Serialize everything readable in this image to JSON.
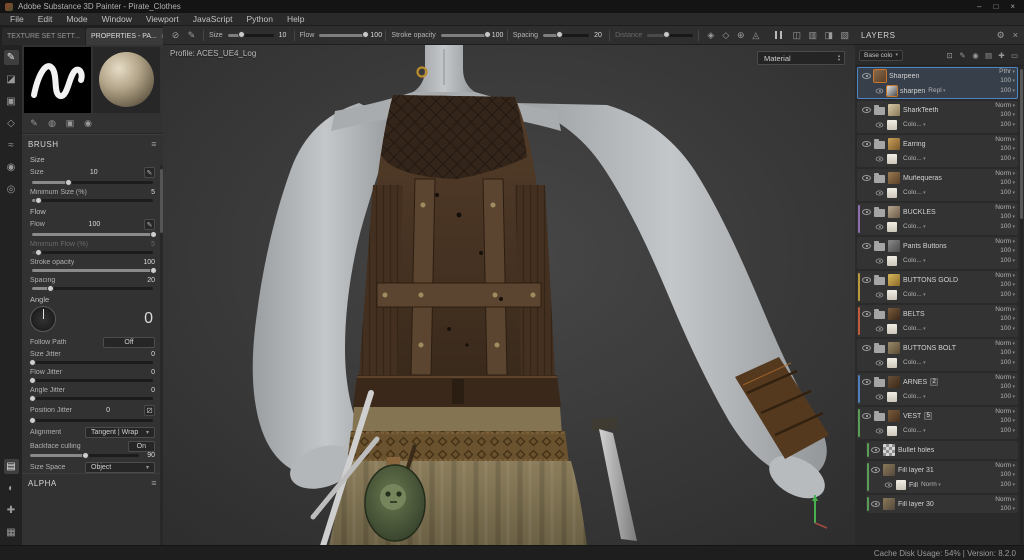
{
  "window": {
    "title": "Adobe Substance 3D Painter - Pirate_Clothes",
    "status": "Cache Disk Usage:  54% | Version: 8.2.0"
  },
  "icons": {
    "minimize": "–",
    "maximize": "□",
    "close": "×",
    "gear": "⚙",
    "caret": "▾",
    "up": "▲",
    "down": "▼",
    "pencil": "✎",
    "list": "≡"
  },
  "menus": [
    "File",
    "Edit",
    "Mode",
    "Window",
    "Viewport",
    "JavaScript",
    "Python",
    "Help"
  ],
  "dock_tabs": {
    "texture_set": "TEXTURE SET SETT...",
    "properties": "PROPERTIES - PA...",
    "close": "×"
  },
  "toolstrip": {
    "top": [
      {
        "name": "paint-tool-icon",
        "glyph": "✎"
      },
      {
        "name": "eraser-tool-icon",
        "glyph": "◪"
      },
      {
        "name": "projection-tool-icon",
        "glyph": "▣"
      },
      {
        "name": "polygon-fill-tool-icon",
        "glyph": "◇"
      },
      {
        "name": "smudge-tool-icon",
        "glyph": "≈"
      },
      {
        "name": "clone-tool-icon",
        "glyph": "◉"
      },
      {
        "name": "material-picker-tool-icon",
        "glyph": "◎"
      }
    ],
    "bottom": [
      {
        "name": "display-settings-icon",
        "glyph": "▤"
      },
      {
        "name": "shader-settings-icon",
        "glyph": "◐"
      },
      {
        "name": "add-texture-icon",
        "glyph": "✚"
      },
      {
        "name": "grid-icon",
        "glyph": "▦"
      }
    ]
  },
  "toolbar": {
    "left_icons": [
      {
        "name": "physical-size-icon",
        "glyph": "⊘"
      },
      {
        "name": "lazy-mouse-icon",
        "glyph": "✎"
      }
    ],
    "size": {
      "label": "Size",
      "value": "10",
      "pct": 30
    },
    "flow": {
      "label": "Flow",
      "value": "100",
      "pct": 100
    },
    "stroke_opacity": {
      "label": "Stroke opacity",
      "value": "100",
      "pct": 100
    },
    "spacing": {
      "label": "Spacing",
      "value": "20",
      "pct": 35
    },
    "distance": {
      "label": "Distance",
      "value": "",
      "pct": 40
    },
    "mid_icons": [
      {
        "name": "alignment-icon",
        "glyph": "◈"
      },
      {
        "name": "symmetry-icon",
        "glyph": "◇"
      },
      {
        "name": "mirror-icon",
        "glyph": "⊕"
      },
      {
        "name": "wrap-icon",
        "glyph": "◬"
      }
    ],
    "right_icons": [
      {
        "name": "perspective-icon",
        "glyph": "◫"
      },
      {
        "name": "camera-icon",
        "glyph": "▥"
      },
      {
        "name": "display-mode-icon",
        "glyph": "◨"
      },
      {
        "name": "viewport-settings-icon",
        "glyph": "▧"
      }
    ]
  },
  "properties": {
    "section_brush": "BRUSH",
    "size_group": "Size",
    "size": {
      "label": "Size",
      "value": "10",
      "pct": 30
    },
    "min_size": {
      "label": "Minimum Size (%)",
      "value": "5",
      "pct": 5
    },
    "flow_group": "Flow",
    "flow": {
      "label": "Flow",
      "value": "100",
      "pct": 100
    },
    "min_flow": {
      "label": "Minimum Flow (%)",
      "value": "5",
      "pct": 5
    },
    "stroke_opacity": {
      "label": "Stroke opacity",
      "value": "100",
      "pct": 100
    },
    "spacing": {
      "label": "Spacing",
      "value": "20",
      "pct": 15
    },
    "angle": {
      "label": "Angle",
      "value": "0"
    },
    "follow_path": {
      "label": "Follow Path",
      "value": "Off"
    },
    "size_jitter": {
      "label": "Size Jitter",
      "value": "0",
      "pct": 0
    },
    "flow_jitter": {
      "label": "Flow Jitter",
      "value": "0",
      "pct": 0
    },
    "angle_jitter": {
      "label": "Angle Jitter",
      "value": "0",
      "pct": 0
    },
    "position_jitter": {
      "label": "Position Jitter",
      "value": "0",
      "pct": 0
    },
    "alignment": {
      "label": "Alignment",
      "value": "Tangent | Wrap"
    },
    "backface": {
      "label": "Backface culling",
      "value": "On",
      "extra": "90",
      "pct": 50
    },
    "size_space": {
      "label": "Size Space",
      "value": "Object"
    },
    "section_alpha": "ALPHA",
    "minitabs": [
      {
        "name": "tab-brush-icon",
        "glyph": "✎"
      },
      {
        "name": "tab-particles-icon",
        "glyph": "◍"
      },
      {
        "name": "tab-material-icon",
        "glyph": "▣"
      },
      {
        "name": "tab-stencil-icon",
        "glyph": "◉"
      }
    ]
  },
  "viewport": {
    "profile": "Profile: ACES_UE4_Log",
    "material_label": "Material"
  },
  "layers": {
    "title": "LAYERS",
    "filter_label": "Base colo",
    "filter_icons": [
      {
        "name": "background-blend-icon",
        "glyph": "⊡"
      },
      {
        "name": "pencil-icon",
        "glyph": "✎"
      },
      {
        "name": "eyedropper-icon",
        "glyph": "◉"
      },
      {
        "name": "add-fill-layer-icon",
        "glyph": "▤"
      },
      {
        "name": "add-folder-icon",
        "glyph": "✚"
      },
      {
        "name": "delete-layer-icon",
        "glyph": "▭"
      }
    ],
    "items": [
      {
        "name": "Sharpeen",
        "kind": "paint",
        "selected": true,
        "thumb": [
          "#8a6a4a",
          "#5a4028"
        ],
        "blend": "Pthr",
        "opacity": "100",
        "sub": {
          "name": "sharpen",
          "blend": "Repl",
          "opacity": "100",
          "thumb": "grad"
        }
      },
      {
        "name": "SharkTeeth",
        "kind": "folder",
        "thumb": [
          "#d8c9a8",
          "#8a7a58"
        ],
        "blend": "Norm",
        "opacity": "100",
        "sub": {
          "name": "",
          "blend": "Colo...",
          "opacity": "100",
          "thumb": "light"
        }
      },
      {
        "name": "Earring",
        "kind": "folder",
        "thumb": [
          "#caa05a",
          "#7a5a2a"
        ],
        "blend": "Norm",
        "opacity": "100",
        "sub": {
          "name": "",
          "blend": "Colo...",
          "opacity": "100",
          "thumb": "light"
        }
      },
      {
        "name": "Muñequeras",
        "kind": "folder",
        "thumb": [
          "#9a7a52",
          "#5a4028"
        ],
        "blend": "Norm",
        "opacity": "100",
        "sub": {
          "name": "",
          "blend": "Colo...",
          "opacity": "100",
          "thumb": "light"
        }
      },
      {
        "name": "BUCKLES",
        "kind": "folder",
        "tag": "#8e6fae",
        "thumb": [
          "#b8a890",
          "#6a5a48"
        ],
        "blend": "Norm",
        "opacity": "100",
        "sub": {
          "name": "",
          "blend": "Colo...",
          "opacity": "100",
          "thumb": "light"
        }
      },
      {
        "name": "Pants Buttons",
        "kind": "folder",
        "thumb": [
          "#8a8a8a",
          "#4a4a4a"
        ],
        "blend": "Norm",
        "opacity": "100",
        "sub": {
          "name": "",
          "blend": "Colo...",
          "opacity": "100",
          "thumb": "light"
        }
      },
      {
        "name": "BUTTONS GOLD",
        "kind": "folder",
        "tag": "#b89a3e",
        "thumb": [
          "#d8b85a",
          "#8a6a2a"
        ],
        "blend": "Norm",
        "opacity": "100",
        "sub": {
          "name": "",
          "blend": "Colo...",
          "opacity": "100",
          "thumb": "light"
        }
      },
      {
        "name": "BELTS",
        "kind": "folder",
        "tag": "#bf5b3c",
        "thumb": [
          "#7a5a3a",
          "#3a281a"
        ],
        "blend": "Norm",
        "opacity": "100",
        "sub": {
          "name": "",
          "blend": "Colo...",
          "opacity": "100",
          "thumb": "light"
        }
      },
      {
        "name": "BUTTONS BOLT",
        "kind": "folder",
        "thumb": [
          "#9a8a6a",
          "#5a4a32"
        ],
        "blend": "Norm",
        "opacity": "100",
        "sub": {
          "name": "",
          "blend": "Colo...",
          "opacity": "100",
          "thumb": "light"
        }
      },
      {
        "name": "ARNES",
        "kind": "folder",
        "tag": "#4f7fbe",
        "badge": "2",
        "thumb": [
          "#6a5038",
          "#3a2818"
        ],
        "blend": "Norm",
        "opacity": "100",
        "sub": {
          "name": "",
          "blend": "Colo...",
          "opacity": "100",
          "thumb": "light"
        }
      },
      {
        "name": "VEST",
        "kind": "folder",
        "tag": "#5a9e55",
        "badge": "5",
        "thumb": [
          "#7a5a3a",
          "#44301f"
        ],
        "blend": "Norm",
        "opacity": "100",
        "sub": {
          "name": "",
          "blend": "Colo...",
          "opacity": "100",
          "thumb": "light"
        }
      },
      {
        "name": "Bullet holes",
        "kind": "mask",
        "indent": true,
        "tag": "#5a9e55",
        "blend": "",
        "opacity": ""
      },
      {
        "name": "Fill layer 31",
        "kind": "fill",
        "indent": true,
        "tag": "#5a9e55",
        "thumb": [
          "#8a7a5a",
          "#55483a"
        ],
        "blend": "Norm",
        "opacity": "100",
        "sub": {
          "name": "Fill",
          "blend": "Norm",
          "opacity": "100",
          "thumb": "light"
        }
      },
      {
        "name": "Fill layer 30",
        "kind": "fill",
        "indent": true,
        "tag": "#5a9e55",
        "thumb": [
          "#8a7a5a",
          "#55483a"
        ],
        "blend": "Norm",
        "opacity": "100"
      }
    ]
  }
}
